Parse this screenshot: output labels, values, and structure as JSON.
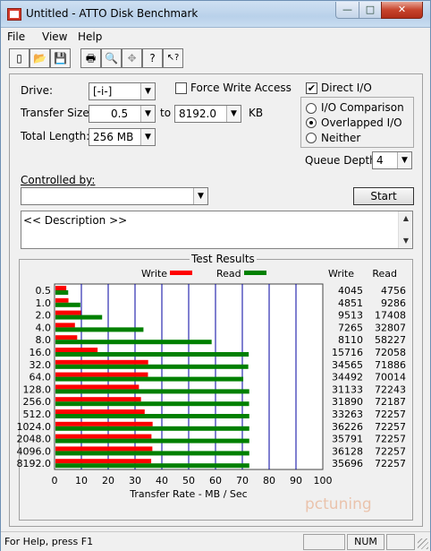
{
  "window": {
    "title": "Untitled - ATTO Disk Benchmark",
    "min_glyph": "—",
    "max_glyph": "□",
    "close_glyph": "✕"
  },
  "menu": [
    "File",
    "View",
    "Help"
  ],
  "toolbar": {
    "icons": [
      "new-document-icon",
      "open-folder-icon",
      "save-icon",
      "print-icon",
      "print-preview-icon",
      "move-icon",
      "help-icon",
      "context-help-icon"
    ],
    "glyphs": [
      "▯",
      "📂",
      "💾",
      "🖶",
      "🔍",
      "✥",
      "?",
      "↖?"
    ]
  },
  "settings": {
    "drive_label": "Drive:",
    "drive_value": "[-i-]",
    "force_write_label": "Force Write Access",
    "force_write_checked": false,
    "direct_io_label": "Direct I/O",
    "direct_io_checked": true,
    "transfer_size_label": "Transfer Size:",
    "transfer_from": "0.5",
    "to_label": "to",
    "transfer_to": "8192.0",
    "kb_label": "KB",
    "total_length_label": "Total Length:",
    "total_length_value": "256 MB",
    "io_modes": [
      {
        "label": "I/O Comparison",
        "selected": false
      },
      {
        "label": "Overlapped I/O",
        "selected": true
      },
      {
        "label": "Neither",
        "selected": false
      }
    ],
    "queue_depth_label": "Queue Depth:",
    "queue_depth_value": "4",
    "controlled_by_label": "Controlled by:",
    "controlled_by_value": "",
    "start_label": "Start",
    "description": "<< Description >>"
  },
  "results": {
    "group_label": "Test Results",
    "legend_write": "Write",
    "legend_read": "Read",
    "col_write": "Write",
    "col_read": "Read",
    "write_color": "#ff0000",
    "read_color": "#008000",
    "grid_color": "#0000a0"
  },
  "chart_data": {
    "type": "bar",
    "orientation": "horizontal",
    "title": "Test Results",
    "xlabel": "Transfer Rate - MB / Sec",
    "xlim": [
      0,
      100
    ],
    "xticks": [
      0,
      10,
      20,
      30,
      40,
      50,
      60,
      70,
      80,
      90,
      100
    ],
    "categories": [
      "0.5",
      "1.0",
      "2.0",
      "4.0",
      "8.0",
      "16.0",
      "32.0",
      "64.0",
      "128.0",
      "256.0",
      "512.0",
      "1024.0",
      "2048.0",
      "4096.0",
      "8192.0"
    ],
    "series": [
      {
        "name": "Write",
        "values": [
          4045,
          4851,
          9513,
          7265,
          8110,
          15716,
          34565,
          34492,
          31133,
          31890,
          33263,
          36226,
          35791,
          36128,
          35696
        ]
      },
      {
        "name": "Read",
        "values": [
          4756,
          9286,
          17408,
          32807,
          58227,
          72058,
          71886,
          70014,
          72243,
          72187,
          72257,
          72257,
          72257,
          72257,
          72257
        ]
      }
    ],
    "legend": "top-center",
    "grid": true
  },
  "status": {
    "help_text": "For Help, press F1",
    "num_label": "NUM"
  },
  "watermark": "pctuning"
}
